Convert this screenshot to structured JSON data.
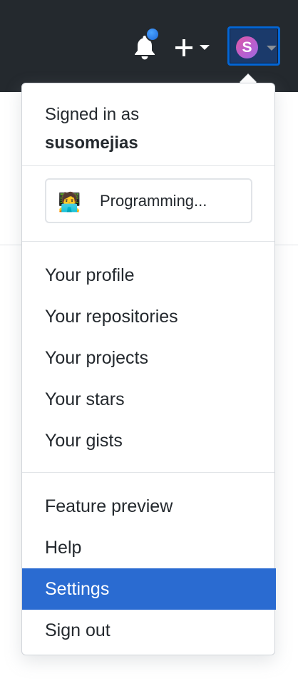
{
  "header": {
    "notifications_icon": "bell-icon",
    "create_icon": "plus-icon",
    "avatar_letter": "S",
    "colors": {
      "bar": "#24292e",
      "accent": "#0366d6",
      "unread_dot": "#2f7fe8"
    }
  },
  "dropdown": {
    "signed_in_as": "Signed in as",
    "username": "susomejias",
    "status": {
      "emoji": "🧑‍💻",
      "text": "Programming..."
    },
    "profile_items": [
      "Your profile",
      "Your repositories",
      "Your projects",
      "Your stars",
      "Your gists"
    ],
    "bottom_items": [
      "Feature preview",
      "Help",
      "Settings",
      "Sign out"
    ],
    "active_item": "Settings",
    "colors": {
      "active_bg": "#2a6bd1"
    }
  }
}
